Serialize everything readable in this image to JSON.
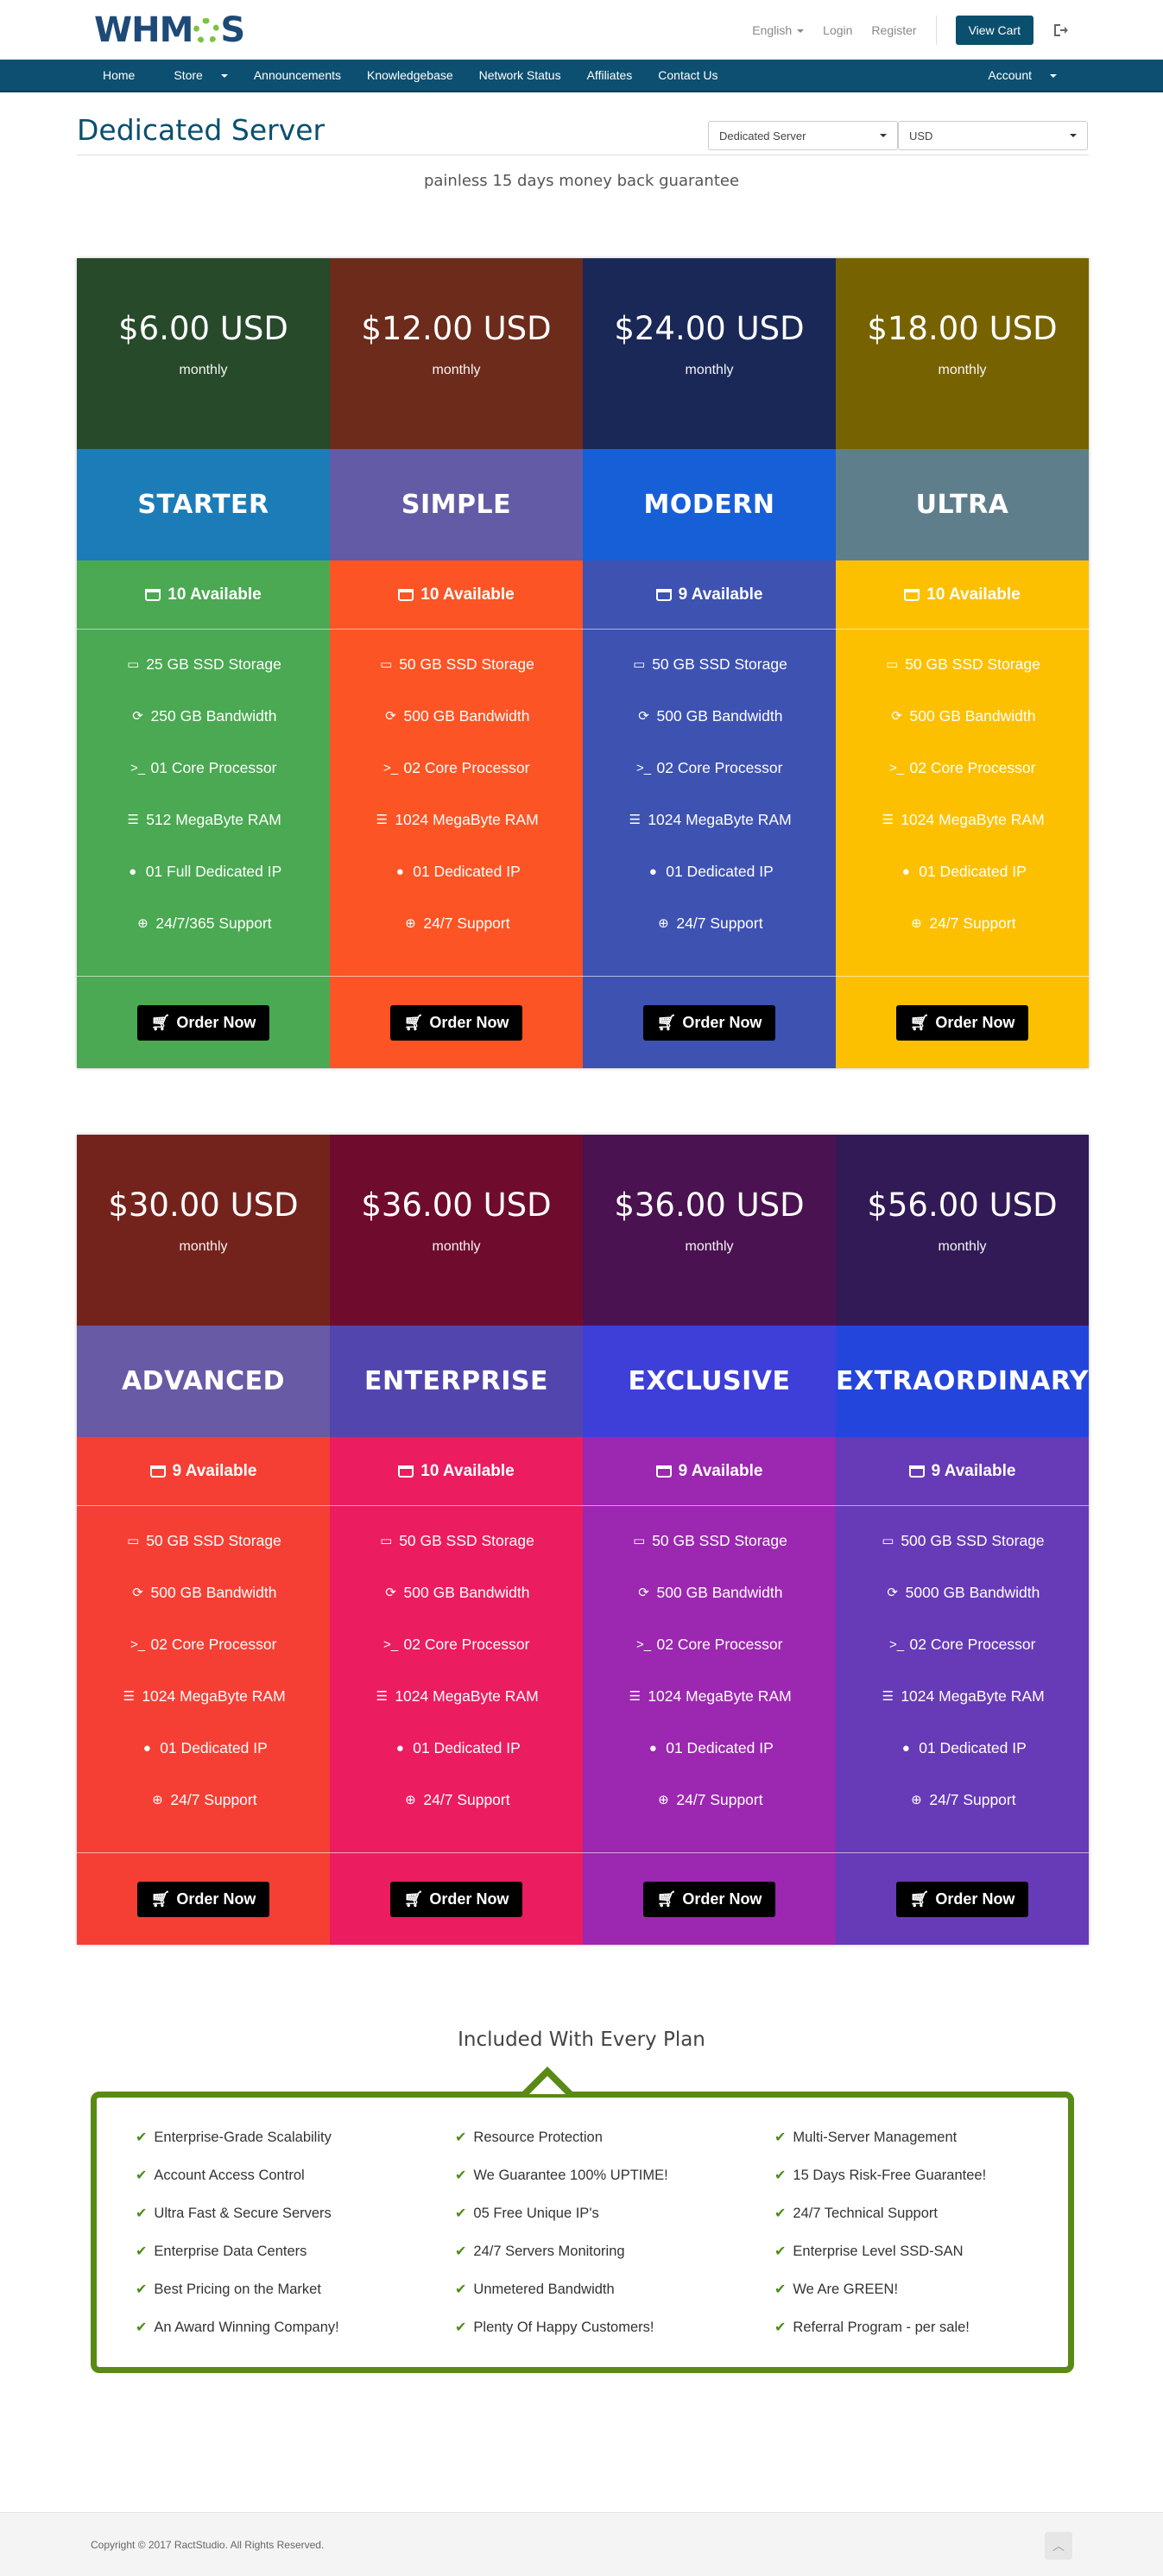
{
  "header": {
    "logo_text_a": "WHM",
    "logo_text_b": "S",
    "language": "English",
    "login": "Login",
    "register": "Register",
    "view_cart": "View Cart"
  },
  "nav": {
    "home": "Home",
    "store": "Store",
    "announcements": "Announcements",
    "knowledgebase": "Knowledgebase",
    "network_status": "Network Status",
    "affiliates": "Affiliates",
    "contact_us": "Contact Us",
    "account": "Account"
  },
  "page": {
    "title": "Dedicated Server",
    "category_select": "Dedicated Server",
    "currency_select": "USD",
    "tagline": "painless 15 days money back guarantee"
  },
  "plans": [
    {
      "price": "$6.00 USD",
      "period": "monthly",
      "name": "STARTER",
      "available": "10 Available",
      "features": [
        "25 GB SSD Storage",
        "250 GB Bandwidth",
        "01 Core Processor",
        "512 MegaByte RAM",
        "01 Full Dedicated IP",
        "24/7/365 Support"
      ],
      "order": "Order Now",
      "colors": {
        "top": "#274a2b",
        "name": "#1c7cb8",
        "body": "#4aa952"
      }
    },
    {
      "price": "$12.00 USD",
      "period": "monthly",
      "name": "SIMPLE",
      "available": "10 Available",
      "features": [
        "50 GB SSD Storage",
        "500 GB Bandwidth",
        "02 Core Processor",
        "1024 MegaByte RAM",
        "01 Dedicated IP",
        "24/7 Support"
      ],
      "order": "Order Now",
      "colors": {
        "top": "#6c2b1b",
        "name": "#645ba6",
        "body": "#fc5424"
      }
    },
    {
      "price": "$24.00 USD",
      "period": "monthly",
      "name": "MODERN",
      "available": "9 Available",
      "features": [
        "50 GB SSD Storage",
        "500 GB Bandwidth",
        "02 Core Processor",
        "1024 MegaByte RAM",
        "01 Dedicated IP",
        "24/7 Support"
      ],
      "order": "Order Now",
      "colors": {
        "top": "#1a2858",
        "name": "#175fd6",
        "body": "#3e52b2"
      }
    },
    {
      "price": "$18.00 USD",
      "period": "monthly",
      "name": "ULTRA",
      "available": "10 Available",
      "features": [
        "50 GB SSD Storage",
        "500 GB Bandwidth",
        "02 Core Processor",
        "1024 MegaByte RAM",
        "01 Dedicated IP",
        "24/7 Support"
      ],
      "order": "Order Now",
      "colors": {
        "top": "#776200",
        "name": "#5f7e8b",
        "body": "#fdc000"
      }
    },
    {
      "price": "$30.00 USD",
      "period": "monthly",
      "name": "ADVANCED",
      "available": "9 Available",
      "features": [
        "50 GB SSD Storage",
        "500 GB Bandwidth",
        "02 Core Processor",
        "1024 MegaByte RAM",
        "01 Dedicated IP",
        "24/7 Support"
      ],
      "order": "Order Now",
      "colors": {
        "top": "#74231c",
        "name": "#685aa5",
        "body": "#f53f34"
      }
    },
    {
      "price": "$36.00 USD",
      "period": "monthly",
      "name": "ENTERPRISE",
      "available": "10 Available",
      "features": [
        "50 GB SSD Storage",
        "500 GB Bandwidth",
        "02 Core Processor",
        "1024 MegaByte RAM",
        "01 Dedicated IP",
        "24/7 Support"
      ],
      "order": "Order Now",
      "colors": {
        "top": "#6f0c2e",
        "name": "#5245ae",
        "body": "#eb1c60"
      }
    },
    {
      "price": "$36.00 USD",
      "period": "monthly",
      "name": "EXCLUSIVE",
      "available": "9 Available",
      "features": [
        "50 GB SSD Storage",
        "500 GB Bandwidth",
        "02 Core Processor",
        "1024 MegaByte RAM",
        "01 Dedicated IP",
        "24/7 Support"
      ],
      "order": "Order Now",
      "colors": {
        "top": "#4a1250",
        "name": "#3e3fd9",
        "body": "#9c27b0"
      }
    },
    {
      "price": "$56.00 USD",
      "period": "monthly",
      "name": "EXTRAORDINARY",
      "available": "9 Available",
      "features": [
        "500 GB SSD Storage",
        "5000 GB Bandwidth",
        "02 Core Processor",
        "1024 MegaByte RAM",
        "01 Dedicated IP",
        "24/7 Support"
      ],
      "order": "Order Now",
      "colors": {
        "top": "#311a55",
        "name": "#2445db",
        "body": "#673ab7"
      }
    }
  ],
  "feature_icons": [
    "hdd-icon",
    "refresh-icon",
    "terminal-icon",
    "memory-icon",
    "globe-icon",
    "support-icon"
  ],
  "included": {
    "title": "Included With Every Plan",
    "items": [
      "Enterprise-Grade Scalability",
      "Resource Protection",
      "Multi-Server Management",
      "Account Access Control",
      "We Guarantee 100% UPTIME!",
      "15 Days Risk-Free Guarantee!",
      "Ultra Fast & Secure Servers",
      "05 Free Unique IP's",
      "24/7 Technical Support",
      "Enterprise Data Centers",
      "24/7 Servers Monitoring",
      "Enterprise Level SSD-SAN",
      "Best Pricing on the Market",
      "Unmetered Bandwidth",
      "We Are GREEN!",
      "An Award Winning Company!",
      "Plenty Of Happy Customers!",
      "Referral Program - per sale!"
    ]
  },
  "footer": {
    "copyright": "Copyright © 2017 RactStudio. All Rights Reserved."
  }
}
